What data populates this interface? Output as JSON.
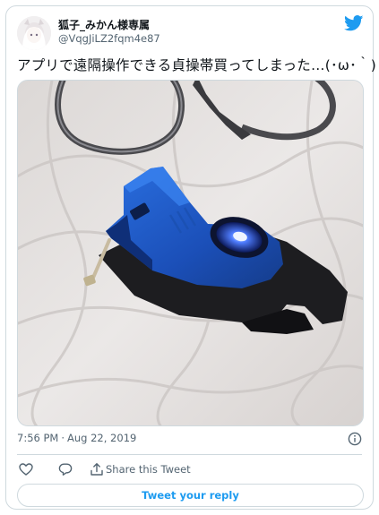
{
  "tweet": {
    "display_name": "狐子_みかん様専属",
    "handle": "@VqgJiLZ2fqm4e87",
    "text": "アプリで遠隔操作できる貞操帯買ってしまった…(･ω･｀)",
    "time": "7:56 PM",
    "separator": "·",
    "date": "Aug 22, 2019"
  },
  "actions": {
    "share_label": "Share this Tweet",
    "reply_button_label": "Tweet your reply"
  },
  "icons": {
    "brand": "twitter-bird-icon",
    "info": "info-icon",
    "like": "heart-icon",
    "reply": "comment-bubble-icon",
    "share": "share-icon"
  },
  "colors": {
    "brand_blue": "#1d9bf0",
    "text_primary": "#0f1419",
    "text_secondary": "#536471",
    "border": "#cfd9de",
    "device_blue": "#1c5fd0"
  }
}
